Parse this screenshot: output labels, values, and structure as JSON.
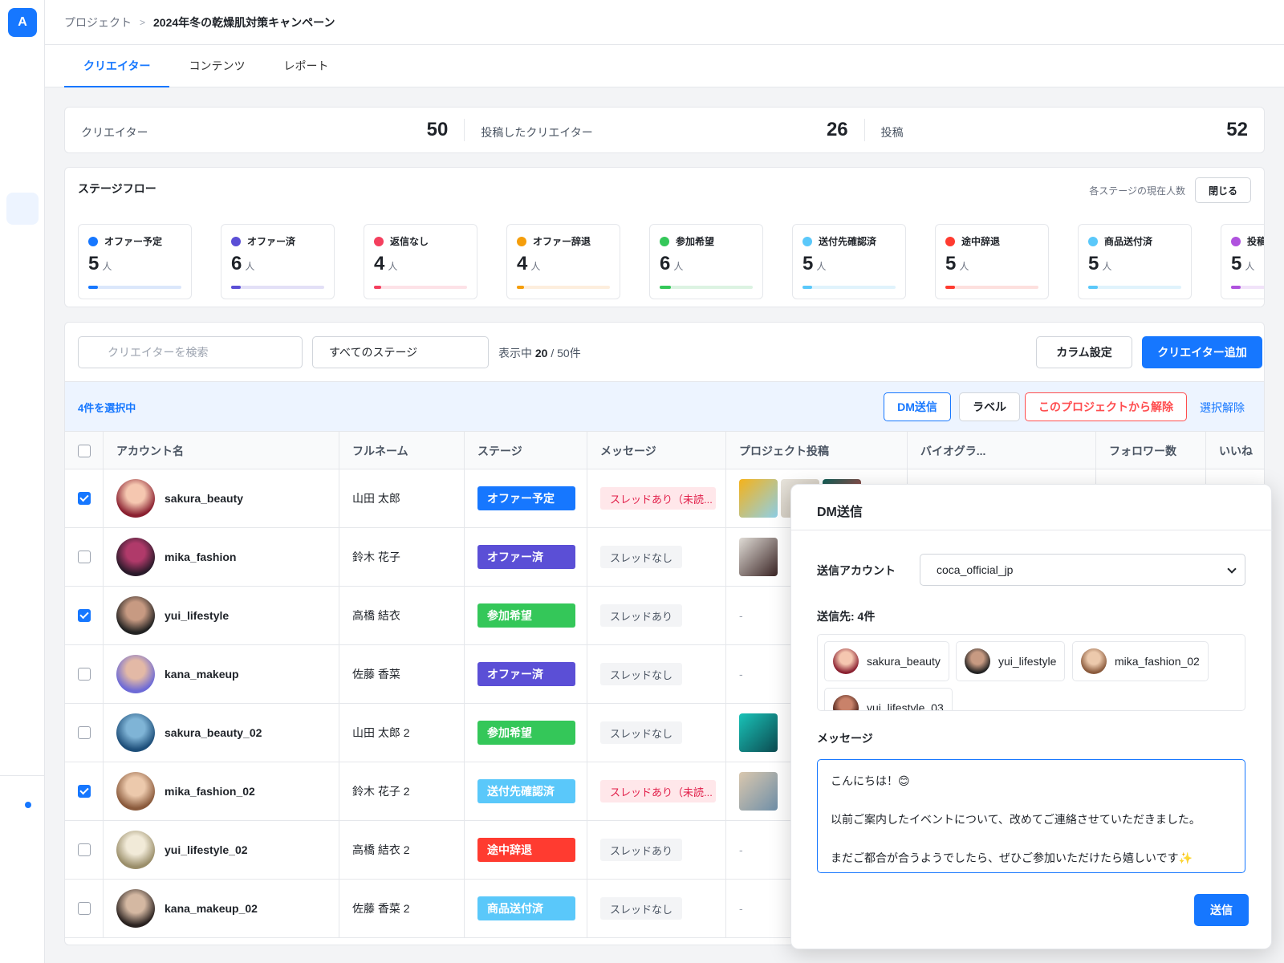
{
  "app": {
    "logo_letter": "A"
  },
  "breadcrumb": {
    "parent": "プロジェクト",
    "separator": ">",
    "current": "2024年冬の乾燥肌対策キャンペーン"
  },
  "tabs": [
    {
      "label": "クリエイター",
      "active": true
    },
    {
      "label": "コンテンツ",
      "active": false
    },
    {
      "label": "レポート",
      "active": false
    }
  ],
  "stats": [
    {
      "label": "クリエイター",
      "value": "50"
    },
    {
      "label": "投稿したクリエイター",
      "value": "26"
    },
    {
      "label": "投稿",
      "value": "52"
    }
  ],
  "stage_flow": {
    "title": "ステージフロー",
    "note": "各ステージの現在人数",
    "close_label": "閉じる",
    "unit": "人",
    "stages": [
      {
        "label": "オファー予定",
        "count": "5",
        "color": "#1677ff",
        "track": "#dbe7fb",
        "fill_fraction": 0.1
      },
      {
        "label": "オファー済",
        "count": "6",
        "color": "#5b4fd6",
        "track": "#e3e0f7",
        "fill_fraction": 0.1
      },
      {
        "label": "返信なし",
        "count": "4",
        "color": "#f43f5e",
        "track": "#fde2e7",
        "fill_fraction": 0.08
      },
      {
        "label": "オファー辞退",
        "count": "4",
        "color": "#f59e0b",
        "track": "#fdeedd",
        "fill_fraction": 0.08
      },
      {
        "label": "参加希望",
        "count": "6",
        "color": "#34c759",
        "track": "#dcf3e2",
        "fill_fraction": 0.12
      },
      {
        "label": "送付先確認済",
        "count": "5",
        "color": "#5ac8fa",
        "track": "#e0f3fc",
        "fill_fraction": 0.1
      },
      {
        "label": "途中辞退",
        "count": "5",
        "color": "#ff3b30",
        "track": "#fde0de",
        "fill_fraction": 0.1
      },
      {
        "label": "商品送付済",
        "count": "5",
        "color": "#5ac8fa",
        "track": "#e0f3fc",
        "fill_fraction": 0.1
      },
      {
        "label": "投稿",
        "count": "5",
        "color": "#af52de",
        "track": "#f1e3f9",
        "fill_fraction": 0.1
      }
    ]
  },
  "toolbar": {
    "search_placeholder": "クリエイターを検索",
    "stage_filter": "すべてのステージ",
    "count_prefix": "表示中",
    "count_shown": "20",
    "count_total": "/ 50件",
    "columns_label": "カラム設定",
    "add_label": "クリエイター追加"
  },
  "selection": {
    "text": "4件を選択中",
    "dm_label": "DM送信",
    "label_label": "ラベル",
    "remove_label": "このプロジェクトから解除",
    "clear_label": "選択解除"
  },
  "table": {
    "columns": [
      "アカウント名",
      "フルネーム",
      "ステージ",
      "メッセージ",
      "プロジェクト投稿",
      "バイオグラ...",
      "フォロワー数",
      "いいね"
    ],
    "rows": [
      {
        "account": "sakura_beauty",
        "fullname": "山田 太郎",
        "stage": "オファー予定",
        "stage_color": "#1677ff",
        "message": "スレッドあり（未読...",
        "unread": true,
        "checked": true,
        "posts": "thumbs",
        "avatar": [
          "#f5c7b0",
          "#8a2030"
        ],
        "thumbs": [
          [
            "#f5b21a",
            "#8ed0e8"
          ],
          [
            "#e8e4dc",
            "#c9c1b4"
          ],
          [
            "#0f5f57",
            "#e24040"
          ]
        ]
      },
      {
        "account": "mika_fashion",
        "fullname": "鈴木 花子",
        "stage": "オファー済",
        "stage_color": "#5b4fd6",
        "message": "スレッドなし",
        "unread": false,
        "checked": false,
        "posts": "thumbs",
        "avatar": [
          "#b03a6a",
          "#2a1a2a"
        ],
        "thumbs": [
          [
            "#e0dcd6",
            "#3a2424"
          ]
        ]
      },
      {
        "account": "yui_lifestyle",
        "fullname": "高橋 結衣",
        "stage": "参加希望",
        "stage_color": "#34c759",
        "message": "スレッドあり",
        "unread": false,
        "checked": true,
        "posts": "-",
        "avatar": [
          "#c79a82",
          "#222222"
        ],
        "thumbs": []
      },
      {
        "account": "kana_makeup",
        "fullname": "佐藤 香菜",
        "stage": "オファー済",
        "stage_color": "#5b4fd6",
        "message": "スレッドなし",
        "unread": false,
        "checked": false,
        "posts": "-",
        "avatar": [
          "#e3b9a6",
          "#6d6ad6"
        ],
        "thumbs": []
      },
      {
        "account": "sakura_beauty_02",
        "fullname": "山田 太郎 2",
        "stage": "参加希望",
        "stage_color": "#34c759",
        "message": "スレッドなし",
        "unread": false,
        "checked": false,
        "posts": "thumbs",
        "avatar": [
          "#7fb4d6",
          "#1e4f7a"
        ],
        "thumbs": [
          [
            "#19c3b8",
            "#0c4a50"
          ]
        ]
      },
      {
        "account": "mika_fashion_02",
        "fullname": "鈴木 花子 2",
        "stage": "送付先確認済",
        "stage_color": "#5ac8fa",
        "message": "スレッドあり（未読...",
        "unread": true,
        "checked": true,
        "posts": "thumbs",
        "avatar": [
          "#ecc9ac",
          "#8a5a3c"
        ],
        "thumbs": [
          [
            "#d9c7ae",
            "#6f8fa8"
          ]
        ]
      },
      {
        "account": "yui_lifestyle_02",
        "fullname": "高橋 結衣 2",
        "stage": "途中辞退",
        "stage_color": "#ff3b30",
        "message": "スレッドあり",
        "unread": false,
        "checked": false,
        "posts": "-",
        "avatar": [
          "#f1ead8",
          "#9a8e6a"
        ],
        "thumbs": []
      },
      {
        "account": "kana_makeup_02",
        "fullname": "佐藤 香菜 2",
        "stage": "商品送付済",
        "stage_color": "#5ac8fa",
        "message": "スレッドなし",
        "unread": false,
        "checked": false,
        "posts": "-",
        "avatar": [
          "#d4b8a2",
          "#2a2220"
        ],
        "thumbs": []
      }
    ]
  },
  "dm_panel": {
    "title": "DM送信",
    "account_label": "送信アカウント",
    "account_value": "coca_official_jp",
    "recipients_label": "送信先: 4件",
    "recipients": [
      {
        "name": "sakura_beauty",
        "avatar": [
          "#f5c7b0",
          "#8a2030"
        ]
      },
      {
        "name": "yui_lifestyle",
        "avatar": [
          "#c79a82",
          "#222222"
        ]
      },
      {
        "name": "mika_fashion_02",
        "avatar": [
          "#ecc9ac",
          "#8a5a3c"
        ]
      },
      {
        "name": "yui_lifestyle_03",
        "avatar": [
          "#c9826a",
          "#4a2018"
        ]
      }
    ],
    "message_label": "メッセージ",
    "message_lines": [
      "こんにちは！😊",
      "",
      "以前ご案内したイベントについて、改めてご連絡させていただきました。",
      "",
      "まだご都合が合うようでしたら、ぜひご参加いただけたら嬉しいです✨"
    ],
    "send_label": "送信"
  }
}
